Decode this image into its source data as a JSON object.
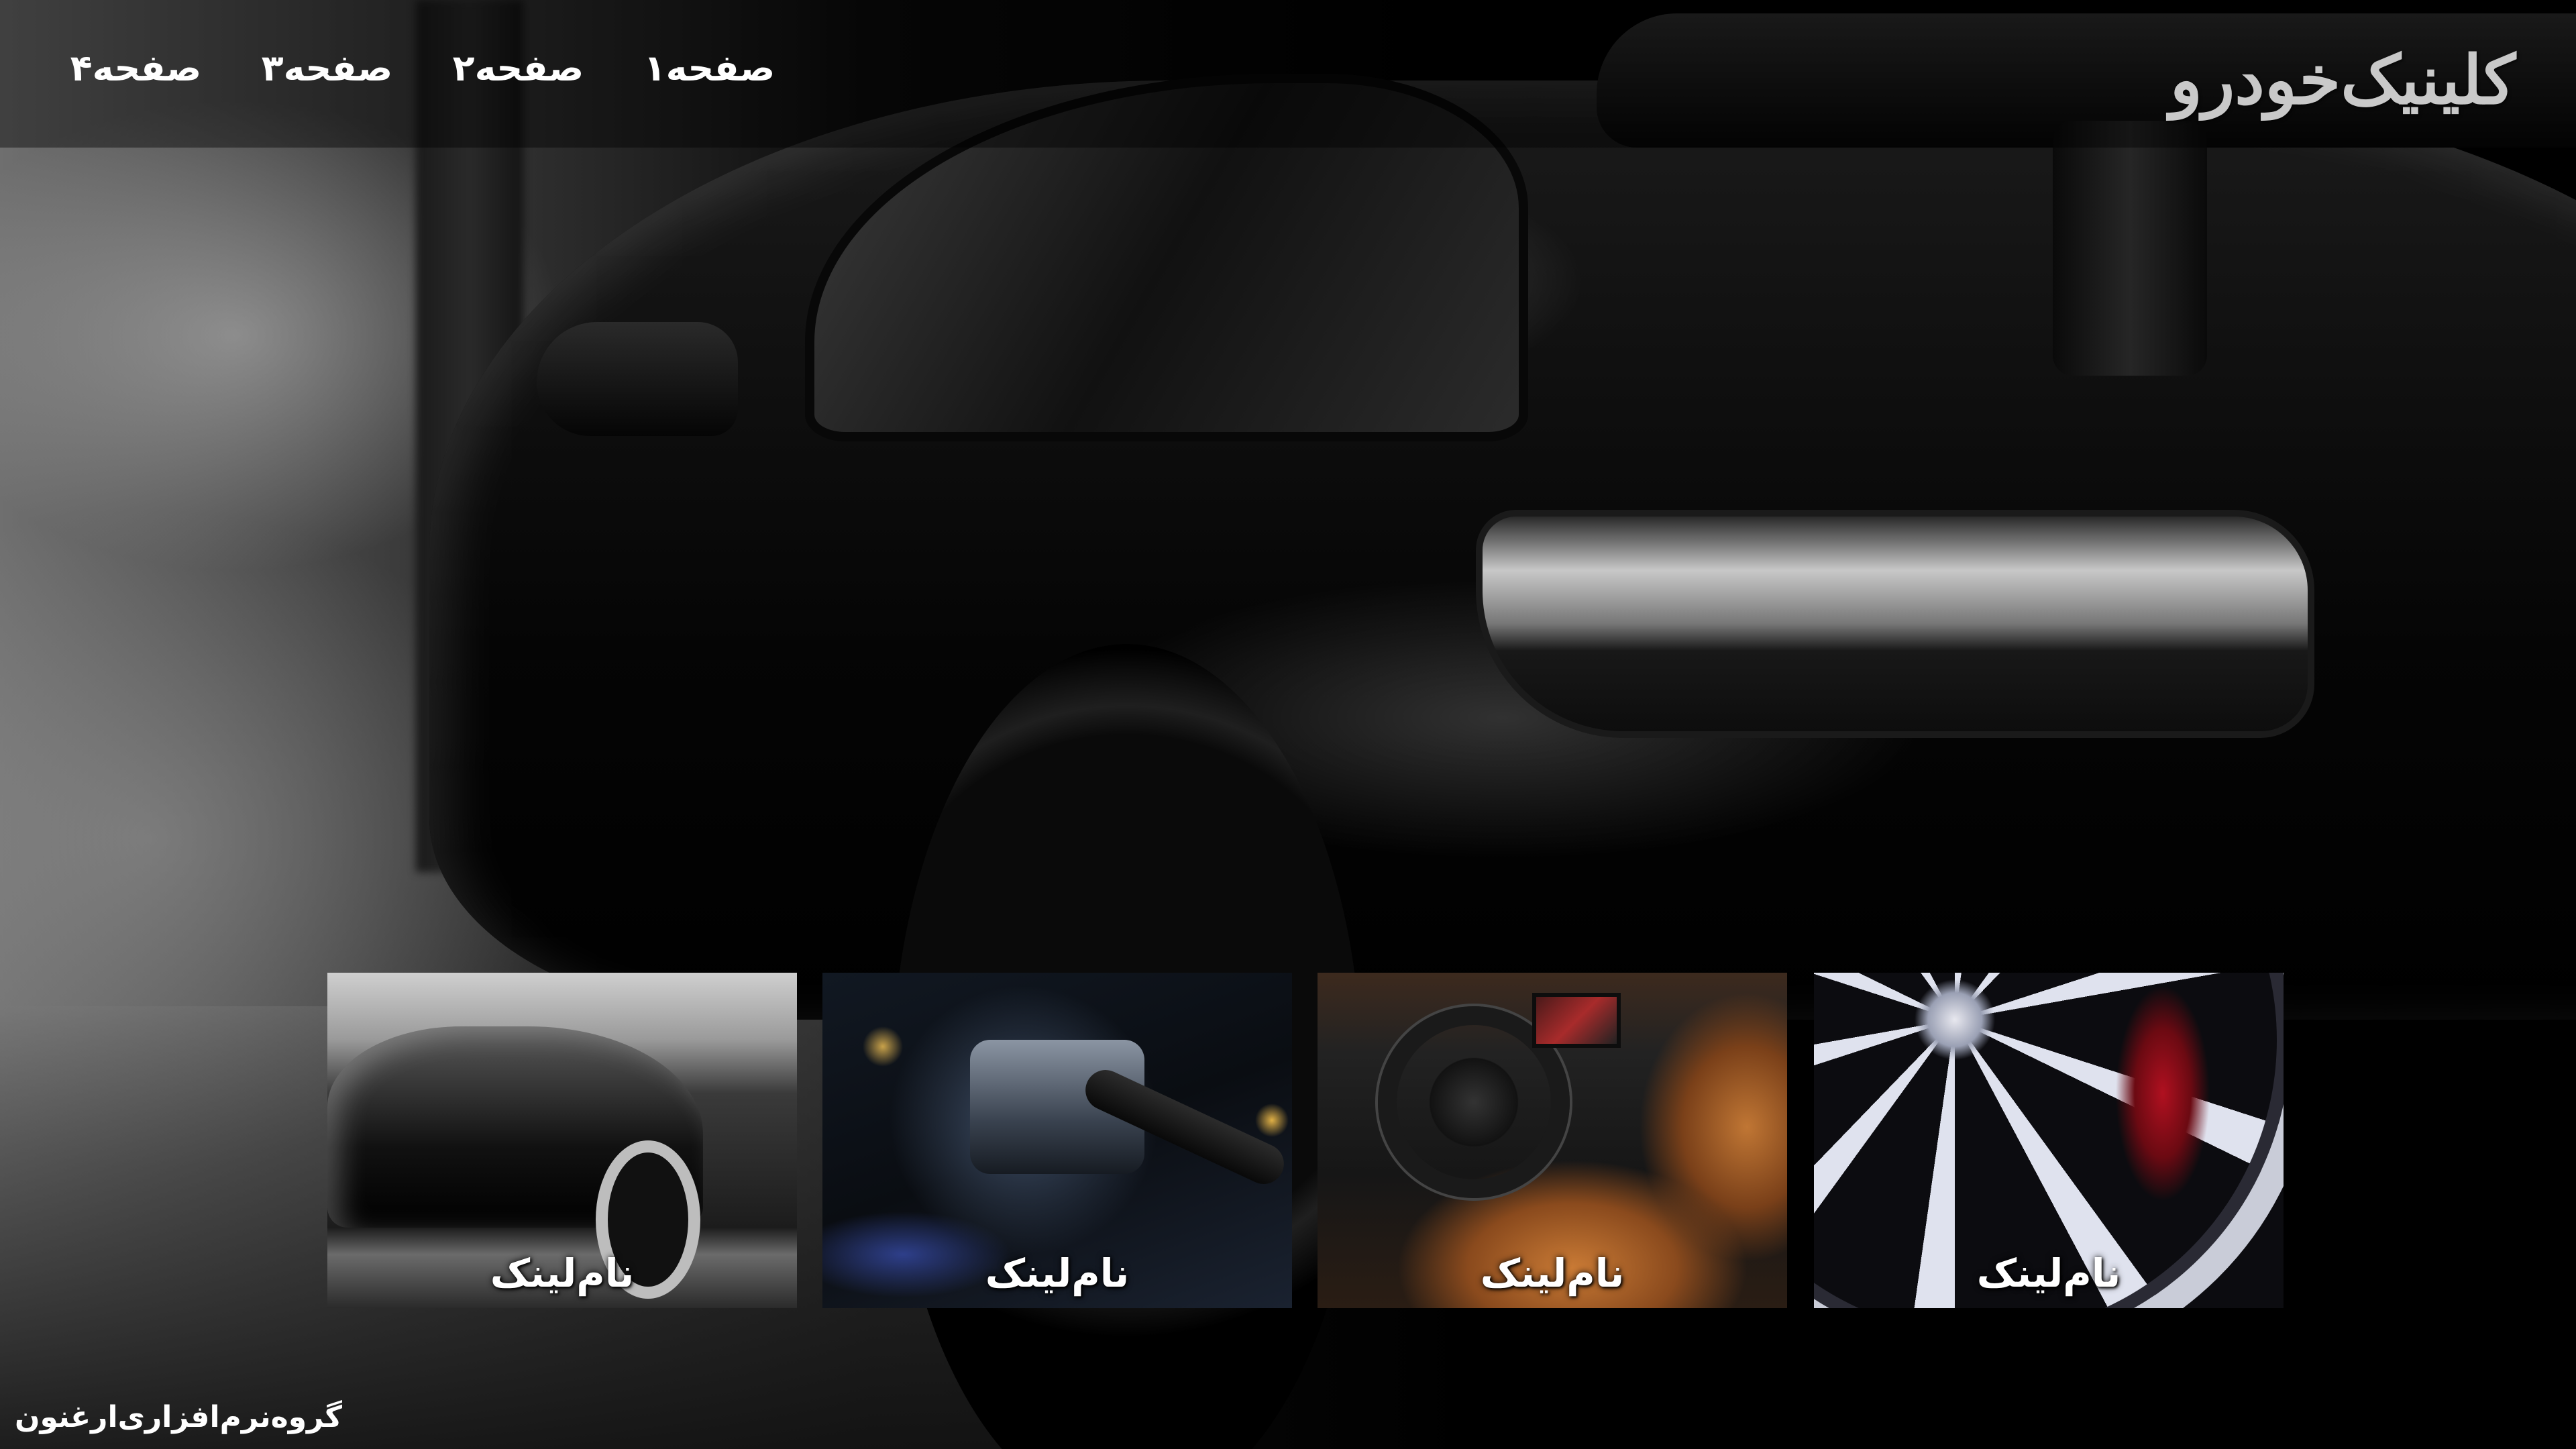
{
  "header": {
    "brand": "کلینیک‌خودرو",
    "nav": [
      {
        "label": "صفحه۱"
      },
      {
        "label": "صفحه۲"
      },
      {
        "label": "صفحه۳"
      },
      {
        "label": "صفحه۴"
      }
    ]
  },
  "tiles": [
    {
      "caption": "نام‌لینک",
      "image": "supercar"
    },
    {
      "caption": "نام‌لینک",
      "image": "engine-bay"
    },
    {
      "caption": "نام‌لینک",
      "image": "car-interior"
    },
    {
      "caption": "نام‌لینک",
      "image": "wheel-rim"
    }
  ],
  "footer": {
    "credit": "گروه‌نرم‌افزاری‌ارغنون"
  },
  "background": {
    "image": "black-sports-car-rear"
  }
}
